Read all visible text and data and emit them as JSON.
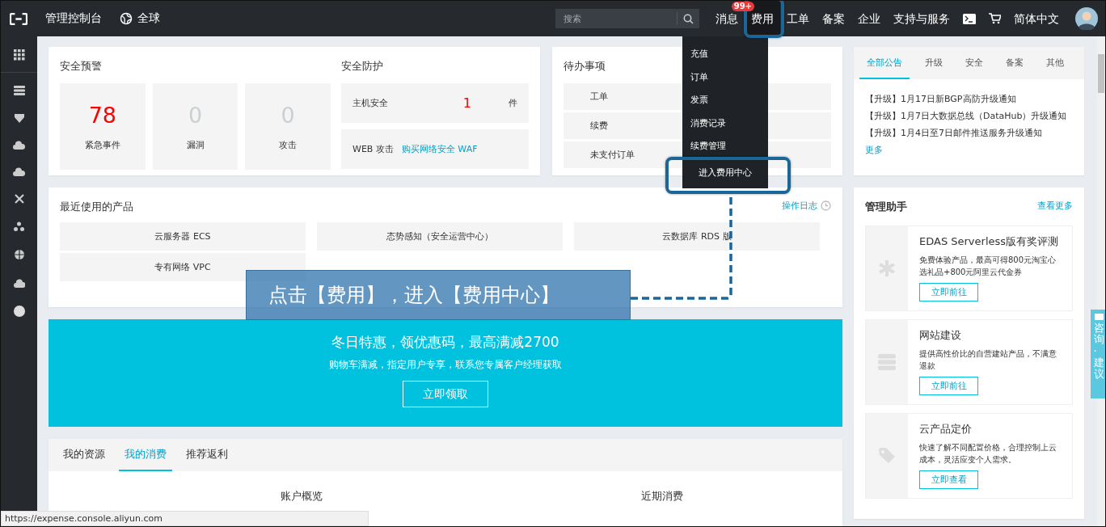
{
  "topbar": {
    "console_label": "管理控制台",
    "region": "全球",
    "search": {
      "placeholder": "搜索"
    },
    "nav": [
      {
        "kind": "text",
        "label": "消息",
        "badge": "99+",
        "selected": false
      },
      {
        "kind": "text",
        "label": "费用",
        "selected": true
      },
      {
        "kind": "text",
        "label": "工单",
        "selected": false
      },
      {
        "kind": "text",
        "label": "备案",
        "selected": false
      },
      {
        "kind": "text",
        "label": "企业",
        "selected": false
      },
      {
        "kind": "text",
        "label": "支持与服务",
        "selected": false
      },
      {
        "kind": "terminal",
        "selected": false
      },
      {
        "kind": "cart",
        "selected": false
      },
      {
        "kind": "text",
        "label": "简体中文",
        "selected": false
      }
    ]
  },
  "fee_menu": {
    "items": [
      {
        "kind": "item",
        "label": "充值"
      },
      {
        "kind": "item",
        "label": "订单"
      },
      {
        "kind": "item",
        "label": "发票"
      },
      {
        "kind": "item",
        "label": "消费记录"
      },
      {
        "kind": "item",
        "label": "续费管理"
      },
      {
        "kind": "footer",
        "label": "进入费用中心"
      }
    ]
  },
  "security_alert": {
    "title": "安全预警",
    "stats": [
      {
        "value": "78",
        "label": "紧急事件",
        "alert": true
      },
      {
        "value": "0",
        "label": "漏洞",
        "alert": false
      },
      {
        "value": "0",
        "label": "攻击",
        "alert": false
      }
    ]
  },
  "security_protection": {
    "title": "安全防护",
    "rows": [
      {
        "kind": "count",
        "label": "主机安全",
        "count": "1",
        "unit": "件"
      },
      {
        "kind": "link",
        "label": "WEB 攻击",
        "link": "购买网络安全 WAF"
      }
    ]
  },
  "todo": {
    "title": "待办事项",
    "items": [
      "工单",
      "续费",
      "未支付订单"
    ]
  },
  "announcements": {
    "tabs": [
      {
        "label": "全部公告",
        "selected": true
      },
      {
        "label": "升级",
        "selected": false
      },
      {
        "label": "安全",
        "selected": false
      },
      {
        "label": "备案",
        "selected": false
      },
      {
        "label": "其他",
        "selected": false
      }
    ],
    "items": [
      "【升级】1月17日新BGP高防升级通知",
      "【升级】1月7日大数据总线（DataHub）升级通知",
      "【升级】1月4日至7日邮件推送服务升级通知"
    ],
    "more": "更多"
  },
  "recent_products": {
    "title": "最近使用的产品",
    "log_link": "操作日志",
    "products": [
      "云服务器 ECS",
      "态势感知（安全运营中心）",
      "云数据库 RDS 版",
      "专有网络 VPC"
    ]
  },
  "banner": {
    "title": "冬日特惠，领优惠码，最高满减2700",
    "subtitle": "购物车满减，指定用户专享，联系您专属客户经理获取",
    "button": "立即领取"
  },
  "assistant": {
    "title": "管理助手",
    "more": "查看更多",
    "cards": [
      {
        "kind": "asterisk",
        "title": "EDAS Serverless版有奖评测",
        "desc": "免费体验产品，最高可得800元淘宝心选礼品+800元阿里云代金券",
        "button": "立即前往"
      },
      {
        "kind": "server",
        "title": "网站建设",
        "desc": "提供高性价比的自营建站产品，不满意退款",
        "button": "立即前往"
      },
      {
        "kind": "tag",
        "title": "云产品定价",
        "desc": "快速了解不同配置价格，合理控制上云成本，灵活应变个人需求。",
        "button": "立即查看"
      }
    ]
  },
  "bottom": {
    "tabs": [
      {
        "label": "我的资源",
        "selected": false
      },
      {
        "label": "我的消费",
        "selected": true
      },
      {
        "label": "推荐返利",
        "selected": false
      }
    ],
    "sections": [
      "账户概览",
      "近期消费"
    ]
  },
  "annotation": {
    "text": "点击【费用】，进入【费用中心】"
  },
  "feedback_tab": {
    "label": "咨询·建议"
  },
  "status_url": "https://expense.console.aliyun.com"
}
